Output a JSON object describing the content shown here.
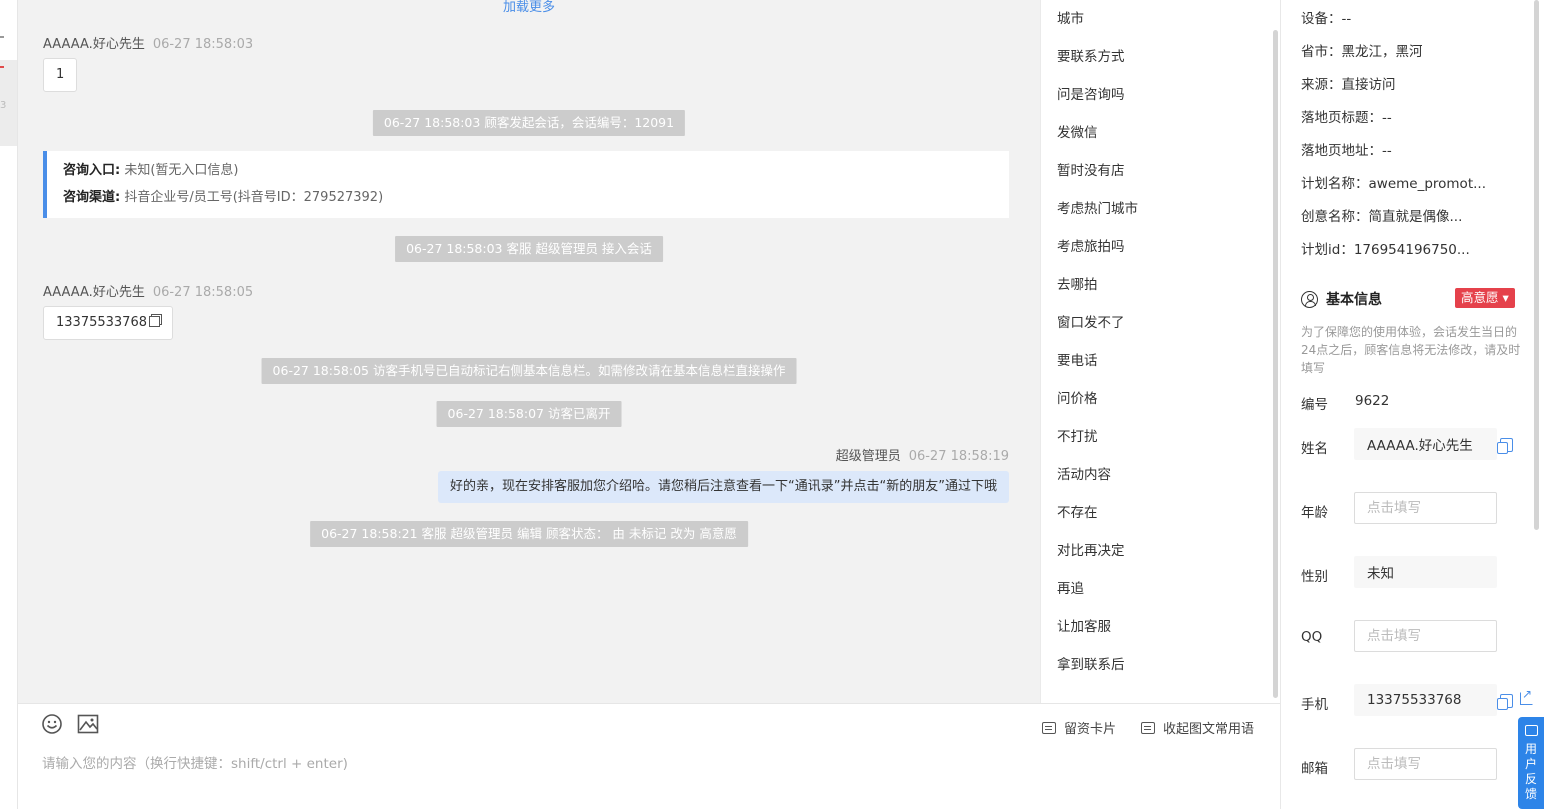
{
  "left_strip": {
    "mark": "3"
  },
  "chat": {
    "load_more": "加载更多",
    "msg1": {
      "name": "AAAAA.好心先生",
      "time": "06-27 18:58:03",
      "text": "1"
    },
    "sys1": "06-27 18:58:03 顾客发起会话，会话编号：12091",
    "info_card": {
      "entry_label": "咨询入口:",
      "entry_value": " 未知(暂无入口信息)",
      "channel_label": "咨询渠道:",
      "channel_value": " 抖音企业号/员工号(抖音号ID：279527392)"
    },
    "sys2": "06-27 18:58:03 客服 超级管理员 接入会话",
    "msg2": {
      "name": "AAAAA.好心先生",
      "time": "06-27 18:58:05",
      "text": "13375533768"
    },
    "sys3": "06-27 18:58:05 访客手机号已自动标记右侧基本信息栏。如需修改请在基本信息栏直接操作",
    "sys4": "06-27 18:58:07 访客已离开",
    "agent_msg": {
      "name": "超级管理员",
      "time": "06-27 18:58:19",
      "text": "好的亲，现在安排客服加您介绍哈。请您稍后注意查看一下“通讯录”并点击“新的朋友”通过下哦"
    },
    "sys5": "06-27 18:58:21 客服 超级管理员 编辑 顾客状态： 由 未标记 改为 高意愿"
  },
  "quick_replies": [
    "城市",
    "要联系方式",
    "问是咨询吗",
    "发微信",
    "暂时没有店",
    "考虑热门城市",
    "考虑旅拍吗",
    "去哪拍",
    "窗口发不了",
    "要电话",
    "问价格",
    "不打扰",
    "活动内容",
    "不存在",
    "对比再决定",
    "再追",
    "让加客服",
    "拿到联系后"
  ],
  "input_area": {
    "placeholder": "请输入您的内容（换行快捷键：shift/ctrl + enter)",
    "card_btn": "留资卡片",
    "collapse_btn": "收起图文常用语",
    "emoji_icon": "smile-icon",
    "image_icon": "image-icon"
  },
  "right_panel": {
    "visit_info": [
      "设备：--",
      "省市：黑龙江，黑河",
      "来源：直接访问",
      "落地页标题：--",
      "落地页地址：--",
      "计划名称：aweme_promot...",
      "创意名称：简直就是偶像...",
      "计划id：176954196750..."
    ],
    "basic_title": "基本信息",
    "intent_tag": "高意愿 ▾",
    "notice": "为了保障您的使用体验，会话发生当日的24点之后，顾客信息将无法修改，请及时填写",
    "fields": {
      "id_label": "编号",
      "id_value": "9622",
      "name_label": "姓名",
      "name_value": "AAAAA.好心先生",
      "age_label": "年龄",
      "age_placeholder": "点击填写",
      "gender_label": "性别",
      "gender_value": "未知",
      "qq_label": "QQ",
      "qq_placeholder": "点击填写",
      "phone_label": "手机",
      "phone_value": "13375533768",
      "email_label": "邮箱",
      "email_placeholder": "点击填写"
    }
  },
  "feedback": "用户反馈",
  "colors": {
    "accent": "#4a8ee8",
    "tag_red": "#e5414b",
    "agent_bubble": "#dce8fa",
    "system_msg": "#cccccc",
    "feedback_blue": "#2d84e8"
  }
}
